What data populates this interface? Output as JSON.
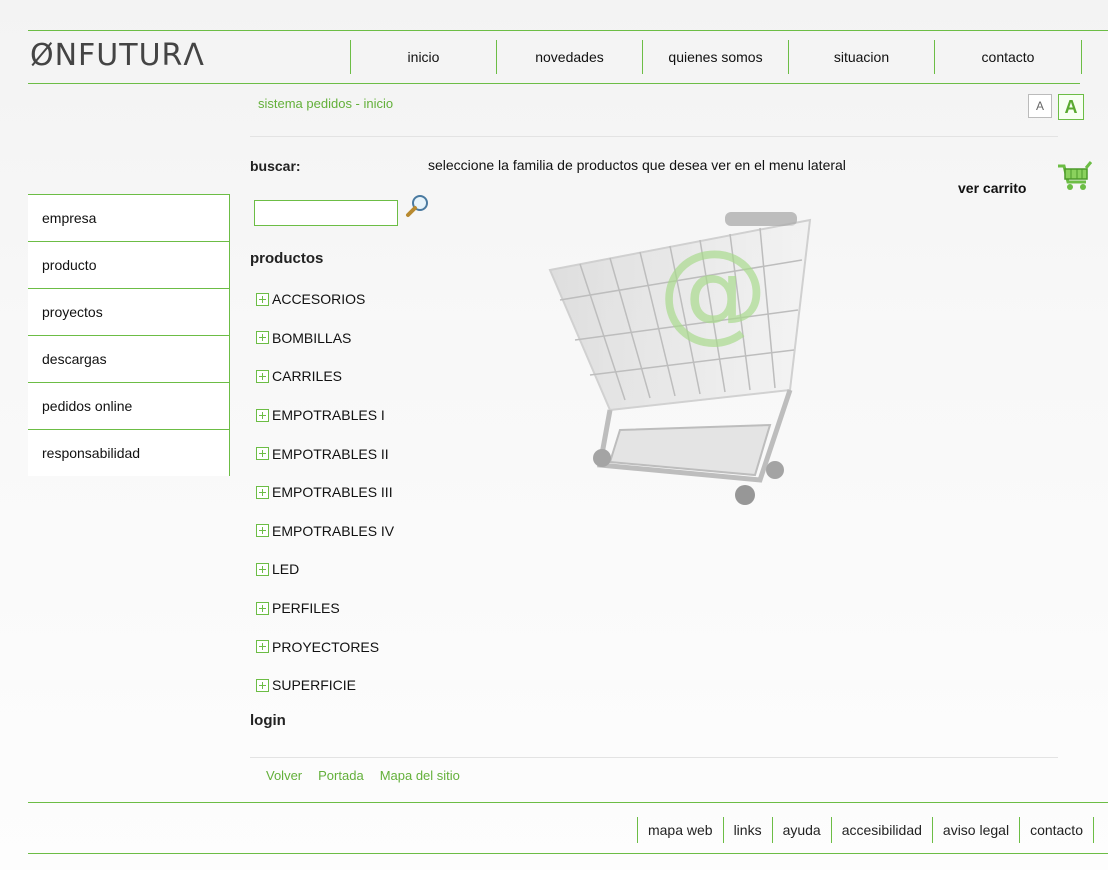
{
  "logo": "ØNFUTURΛ",
  "top_nav": [
    "inicio",
    "novedades",
    "quienes somos",
    "situacion",
    "contacto"
  ],
  "breadcrumb": "sistema pedidos - inicio",
  "font_controls": {
    "decrease": "A",
    "increase": "A"
  },
  "sidebar": [
    "empresa",
    "producto",
    "proyectos",
    "descargas",
    "pedidos online",
    "responsabilidad"
  ],
  "search": {
    "label": "buscar:",
    "value": "",
    "button_icon": "magnifier-icon"
  },
  "hint": "seleccione la familia de productos que desea ver en el menu lateral",
  "cart": {
    "label": "ver carrito",
    "icon": "shopping-cart-icon"
  },
  "products": {
    "title": "productos",
    "items": [
      "ACCESORIOS",
      "BOMBILLAS",
      "CARRILES",
      "EMPOTRABLES I",
      "EMPOTRABLES II",
      "EMPOTRABLES III",
      "EMPOTRABLES IV",
      "LED",
      "PERFILES",
      "PROYECTORES",
      "SUPERFICIE"
    ]
  },
  "login": "login",
  "footer_links": [
    "Volver",
    "Portada",
    "Mapa del sitio"
  ],
  "bottom_nav": [
    "mapa web",
    "links",
    "ayuda",
    "accesibilidad",
    "aviso legal",
    "contacto"
  ],
  "colors": {
    "accent": "#6cbd45",
    "text": "#111111",
    "link": "#63b03a"
  }
}
